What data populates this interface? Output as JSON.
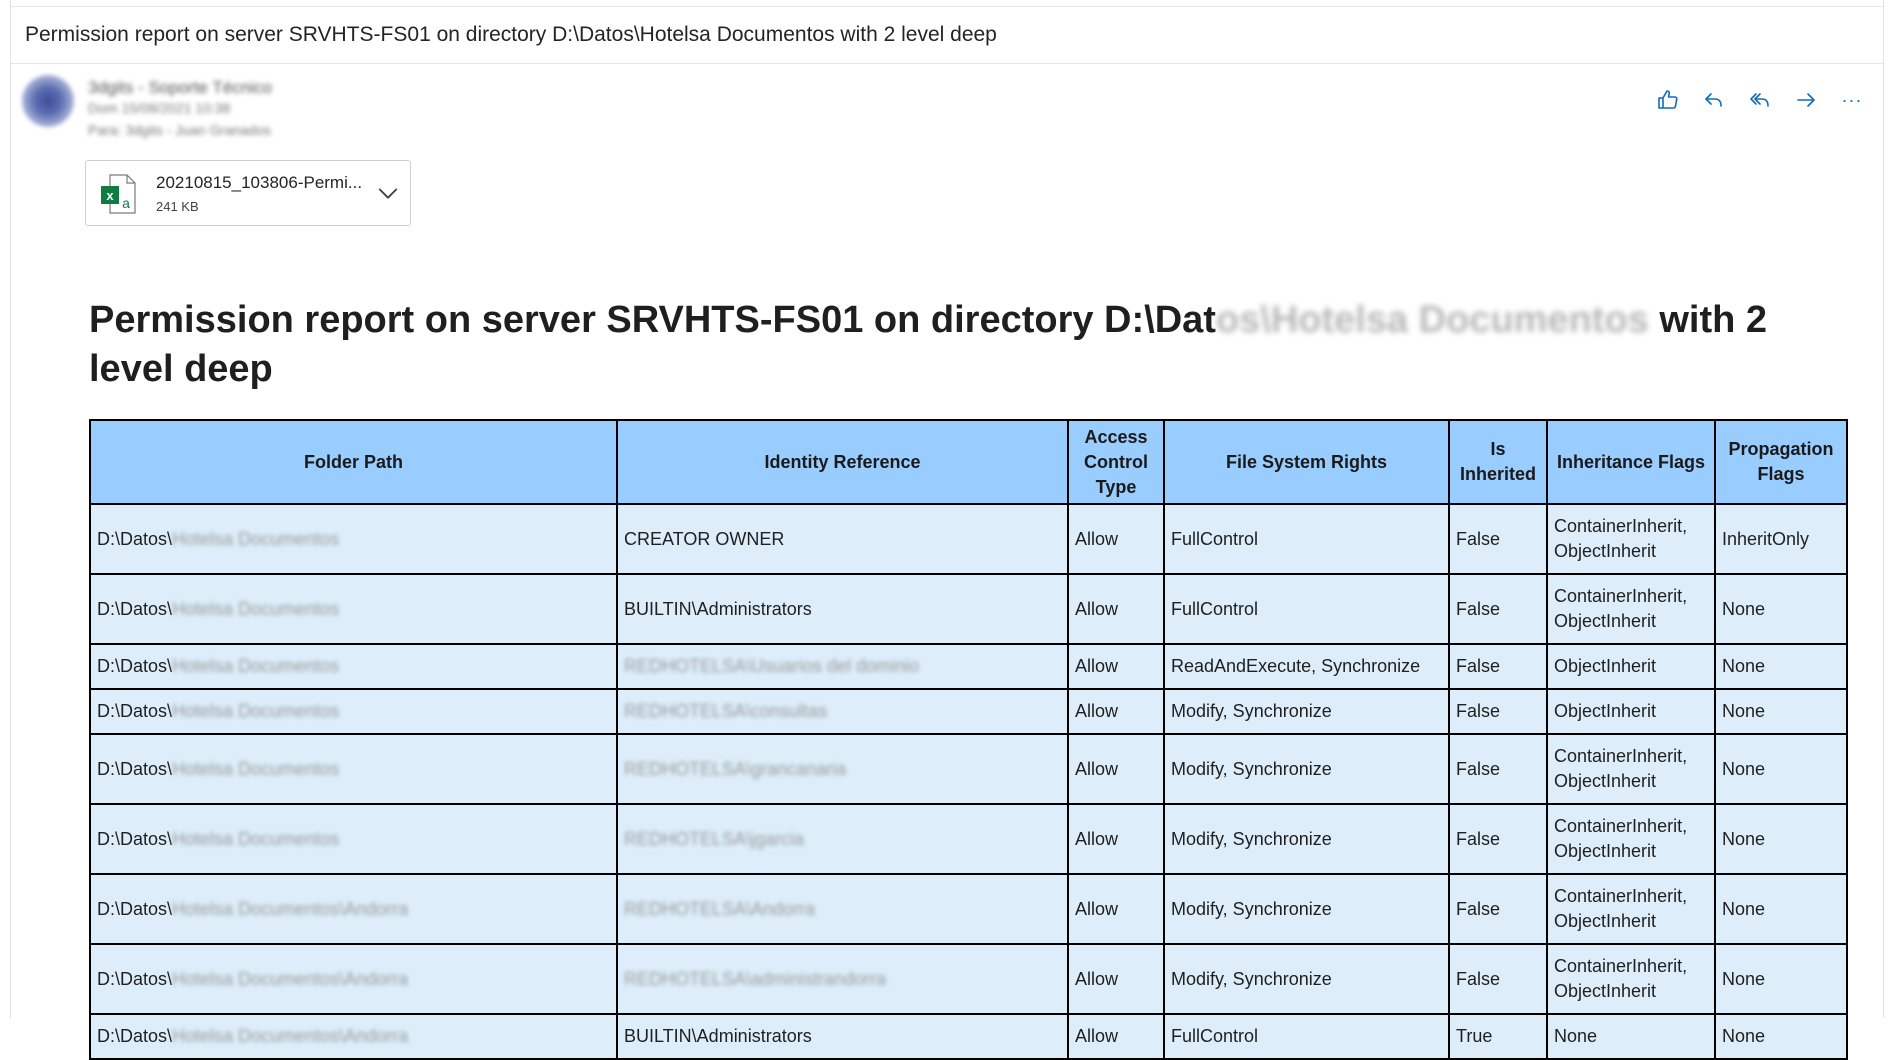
{
  "subject": "Permission report on server SRVHTS-FS01 on directory D:\\Datos\\Hotelsa Documentos with 2 level deep",
  "sender": {
    "name": "3dgits - Soporte Técnico",
    "date": "Dom 15/08/2021 10:38",
    "to": "Para: 3dgits - Juan Granados"
  },
  "actions": {
    "like": "thumbs-up-icon",
    "reply": "reply-icon",
    "reply_all": "reply-all-icon",
    "forward": "forward-icon",
    "more": "···"
  },
  "attachment": {
    "name": "20210815_103806-Permi...",
    "size": "241 KB"
  },
  "report": {
    "title_pre": "Permission report on server SRVHTS-FS01 on directory D:\\Dat",
    "title_blur": "os\\Hotelsa Documentos",
    "title_post": " with 2 level deep"
  },
  "table": {
    "headers": [
      "Folder Path",
      "Identity Reference",
      "Access Control Type",
      "File System Rights",
      "Is Inherited",
      "Inheritance Flags",
      "Propagation Flags"
    ],
    "rows": [
      {
        "path": "D:\\Datos\\",
        "path_blur": "Hotelsa Documentos",
        "identity": "CREATOR OWNER",
        "identity_blur": "",
        "type": "Allow",
        "rights": "FullControl",
        "inherited": "False",
        "inh_flags": "ContainerInherit, ObjectInherit",
        "prop_flags": "InheritOnly"
      },
      {
        "path": "D:\\Datos\\",
        "path_blur": "Hotelsa Documentos",
        "identity": "BUILTIN\\Administrators",
        "identity_blur": "",
        "type": "Allow",
        "rights": "FullControl",
        "inherited": "False",
        "inh_flags": "ContainerInherit, ObjectInherit",
        "prop_flags": "None"
      },
      {
        "path": "D:\\Datos\\",
        "path_blur": "Hotelsa Documentos",
        "identity": "",
        "identity_blur": "REDHOTELSA\\Usuarios del dominio",
        "type": "Allow",
        "rights": "ReadAndExecute, Synchronize",
        "inherited": "False",
        "inh_flags": "ObjectInherit",
        "prop_flags": "None"
      },
      {
        "path": "D:\\Datos\\",
        "path_blur": "Hotelsa Documentos",
        "identity": "",
        "identity_blur": "REDHOTELSA\\consultas",
        "type": "Allow",
        "rights": "Modify, Synchronize",
        "inherited": "False",
        "inh_flags": "ObjectInherit",
        "prop_flags": "None"
      },
      {
        "path": "D:\\Datos\\",
        "path_blur": "Hotelsa Documentos",
        "identity": "",
        "identity_blur": "REDHOTELSA\\grancanaria",
        "type": "Allow",
        "rights": "Modify, Synchronize",
        "inherited": "False",
        "inh_flags": "ContainerInherit, ObjectInherit",
        "prop_flags": "None"
      },
      {
        "path": "D:\\Datos\\",
        "path_blur": "Hotelsa Documentos",
        "identity": "",
        "identity_blur": "REDHOTELSA\\jgarcia",
        "type": "Allow",
        "rights": "Modify, Synchronize",
        "inherited": "False",
        "inh_flags": "ContainerInherit, ObjectInherit",
        "prop_flags": "None"
      },
      {
        "path": "D:\\Datos\\",
        "path_blur": "Hotelsa Documentos\\Andorra",
        "identity": "",
        "identity_blur": "REDHOTELSA\\Andorra",
        "type": "Allow",
        "rights": "Modify, Synchronize",
        "inherited": "False",
        "inh_flags": "ContainerInherit, ObjectInherit",
        "prop_flags": "None"
      },
      {
        "path": "D:\\Datos\\",
        "path_blur": "Hotelsa Documentos\\Andorra",
        "identity": "",
        "identity_blur": "REDHOTELSA\\administrandorra",
        "type": "Allow",
        "rights": "Modify, Synchronize",
        "inherited": "False",
        "inh_flags": "ContainerInherit, ObjectInherit",
        "prop_flags": "None"
      },
      {
        "path": "D:\\Datos\\",
        "path_blur": "Hotelsa Documentos\\Andorra",
        "identity": "BUILTIN\\Administrators",
        "identity_blur": "",
        "type": "Allow",
        "rights": "FullControl",
        "inherited": "True",
        "inh_flags": "None",
        "prop_flags": "None"
      }
    ]
  }
}
